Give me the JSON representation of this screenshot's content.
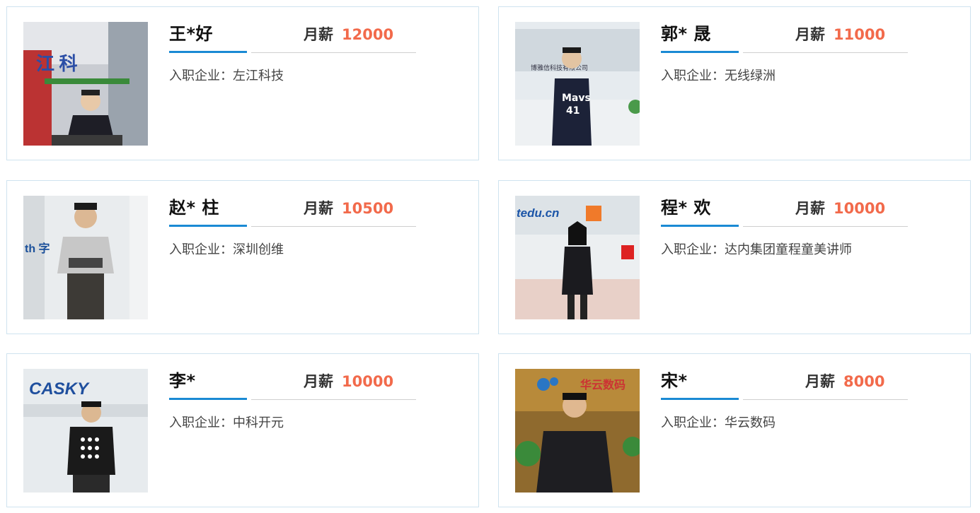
{
  "salary_label": "月薪",
  "company_prefix": "入职企业：",
  "cards": [
    {
      "name": "王*好",
      "salary": "12000",
      "company": "左江科技",
      "photo_text": "江 科"
    },
    {
      "name": "郭* 晟",
      "salary": "11000",
      "company": "无线绿洲",
      "photo_text": "博雅信科技有限公司"
    },
    {
      "name": "赵* 柱",
      "salary": "10500",
      "company": "深圳创维",
      "photo_text": "th 字"
    },
    {
      "name": "程* 欢",
      "salary": "10000",
      "company": "达内集团童程童美讲师",
      "photo_text": "tedu.cn"
    },
    {
      "name": "李*",
      "salary": "10000",
      "company": "中科开元",
      "photo_text": "CASKY"
    },
    {
      "name": "宋*",
      "salary": "8000",
      "company": "华云数码",
      "photo_text": "华云数码"
    }
  ],
  "colors": {
    "accent_blue": "#1a8ad4",
    "salary_orange": "#f26a4b",
    "card_border": "#cfe3ef"
  }
}
